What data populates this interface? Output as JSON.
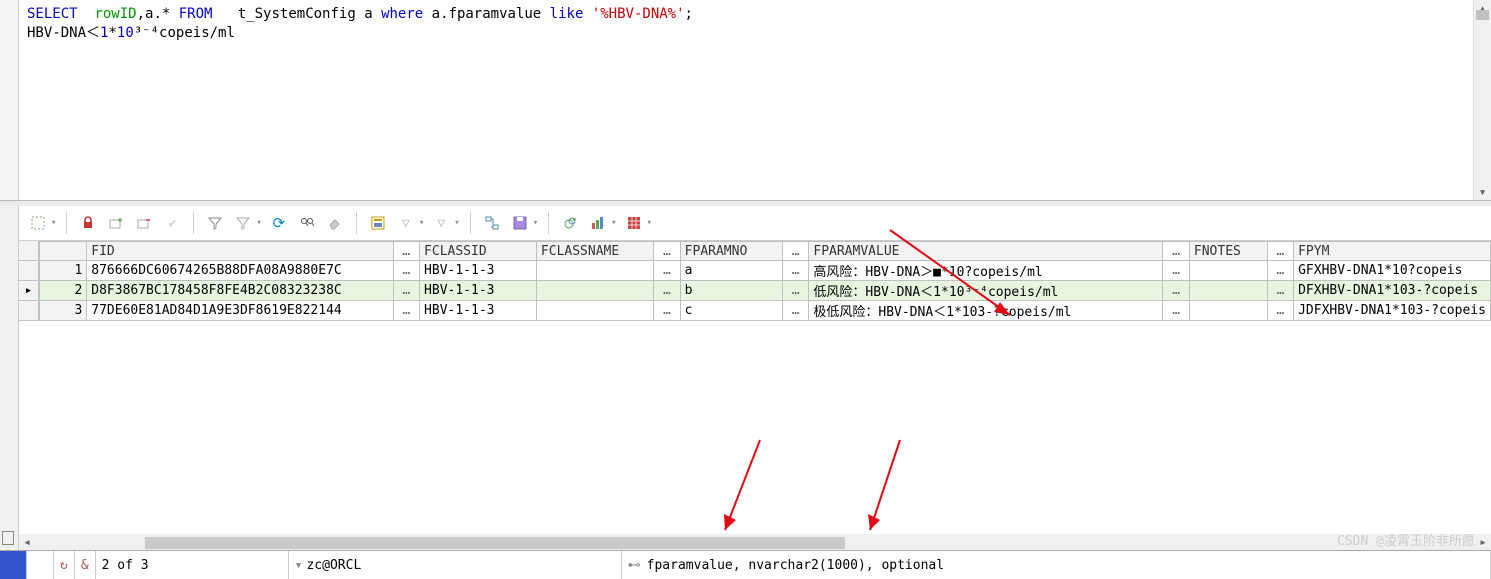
{
  "editor": {
    "select": "SELECT",
    "rowid": "rowID",
    "comma_a_star": ",a.*",
    "from": "FROM",
    "table": "t_SystemConfig a",
    "where": "where",
    "col": "a.fparamvalue",
    "like": "like",
    "literal": "'%HBV-DNA%'",
    "semicolon": ";",
    "line2_prefix": "HBV-DNA＜",
    "line2_num1": "1",
    "line2_star": "*",
    "line2_num2": "10",
    "line2_sup": "³⁻⁴",
    "line2_suffix": "copeis/ml"
  },
  "toolbar": {
    "refresh": "⟳"
  },
  "table": {
    "headers": {
      "fid": "FID",
      "fclassid": "FCLASSID",
      "fclassname": "FCLASSNAME",
      "fparamno": "FPARAMNO",
      "fparamvalue": "FPARAMVALUE",
      "fnotes": "FNOTES",
      "fpym": "FPYM"
    },
    "rows": [
      {
        "n": "1",
        "fid": "876666DC60674265B88DFA08A9880E7C",
        "fclassid": "HBV-1-1-3",
        "fclassname": "",
        "fparamno": "a",
        "fparamvalue": "高风险：HBV-DNA＞■*10?copeis/ml",
        "fnotes": "",
        "fpym": "GFXHBV-DNA1*10?copeis"
      },
      {
        "n": "2",
        "fid": "D8F3867BC178458F8FE4B2C08323238C",
        "fclassid": "HBV-1-1-3",
        "fclassname": "",
        "fparamno": "b",
        "fparamvalue": "低风险：HBV-DNA＜1*10³⁻⁴copeis/ml",
        "fnotes": "",
        "fpym": "DFXHBV-DNA1*103-?copeis"
      },
      {
        "n": "3",
        "fid": "77DE60E81AD84D1A9E3DF8619E822144",
        "fclassid": "HBV-1-1-3",
        "fclassname": "",
        "fparamno": "c",
        "fparamvalue": "极低风险：HBV-DNA＜1*103-?copeis/ml",
        "fnotes": "",
        "fpym": "JDFXHBV-DNA1*103-?copeis"
      }
    ]
  },
  "status": {
    "amp": "&",
    "pos": "2 of 3",
    "conn": "zc@ORCL",
    "field": "fparamvalue, nvarchar2(1000), optional"
  },
  "watermark": "CSDN @凌霄玉阶非所愿"
}
